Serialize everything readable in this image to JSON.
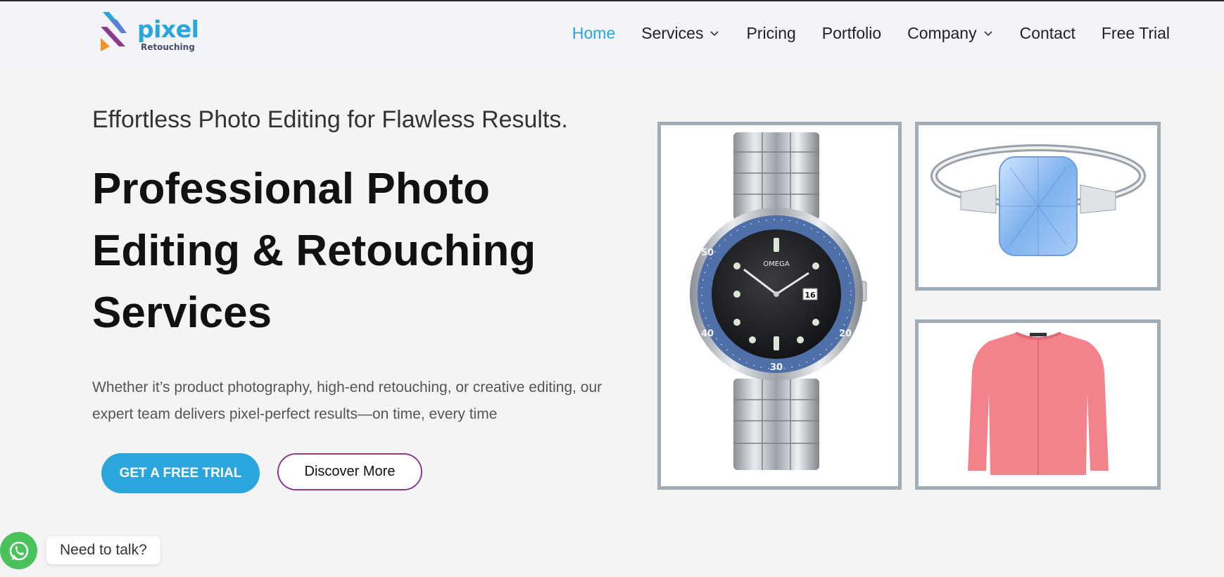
{
  "brand": {
    "name": "pixel",
    "subname": "Retouching",
    "accent": "#2aa6dc",
    "logo_colors": [
      "#2aa6dc",
      "#8e3a8d",
      "#f0932b"
    ]
  },
  "nav": {
    "items": [
      {
        "label": "Home",
        "active": true,
        "dropdown": false
      },
      {
        "label": "Services",
        "active": false,
        "dropdown": true
      },
      {
        "label": "Pricing",
        "active": false,
        "dropdown": false
      },
      {
        "label": "Portfolio",
        "active": false,
        "dropdown": false
      },
      {
        "label": "Company",
        "active": false,
        "dropdown": true
      },
      {
        "label": "Contact",
        "active": false,
        "dropdown": false
      },
      {
        "label": "Free Trial",
        "active": false,
        "dropdown": false
      }
    ]
  },
  "hero": {
    "tagline": "Effortless Photo Editing for Flawless Results.",
    "title": "Professional Photo Editing & Retouching Services",
    "description": "Whether it’s product photography, high-end retouching, or creative editing, our expert team delivers pixel-perfect results—on time, every time",
    "cta_primary": "GET A FREE TRIAL",
    "cta_secondary": "Discover More",
    "primary_color": "#2aa6dc",
    "secondary_border_color": "#8e3a8d"
  },
  "gallery": {
    "images": [
      {
        "icon": "watch-image",
        "subject": "watch"
      },
      {
        "icon": "ring-image",
        "subject": "ring"
      },
      {
        "icon": "sweater-image",
        "subject": "sweater"
      }
    ],
    "watch_markings": {
      "brand": "OMEGA",
      "date": "16",
      "bezel": [
        "50",
        "40",
        "30",
        "20"
      ]
    }
  },
  "chat": {
    "label": "Need to talk?",
    "icon": "whatsapp-icon",
    "color": "#4ac15a"
  }
}
